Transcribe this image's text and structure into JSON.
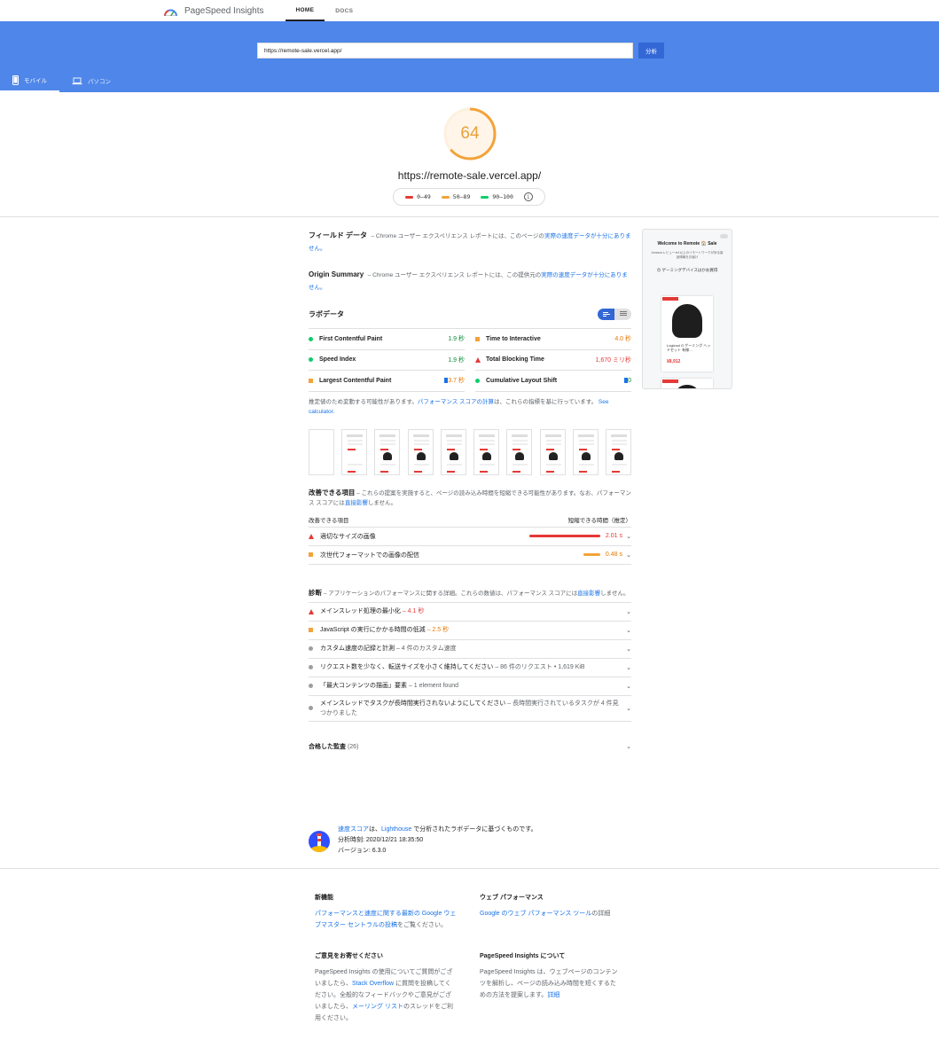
{
  "header": {
    "title": "PageSpeed Insights",
    "tabs": [
      "HOME",
      "DOCS"
    ]
  },
  "search": {
    "url": "https://remote-sale.vercel.app/",
    "analyze_label": "分析"
  },
  "device_tabs": [
    "モバイル",
    "パソコン"
  ],
  "score": {
    "value": "64",
    "url": "https://remote-sale.vercel.app/",
    "legend": [
      "0–49",
      "50–89",
      "90–100"
    ]
  },
  "field_data": {
    "title": "フィールド データ",
    "desc_pre": "– Chrome ユーザー エクスペリエンス レポートには、このページの",
    "desc_link": "実際の速度データが十分にありません。"
  },
  "origin_summary": {
    "title": "Origin Summary",
    "desc_pre": "– Chrome ユーザー エクスペリエンス レポートには、この提供元の",
    "desc_link": "実際の速度データが十分にありません。"
  },
  "lab": {
    "title": "ラボデータ",
    "metrics": [
      {
        "label": "First Contentful Paint",
        "value": "1.9 秒",
        "status": "good"
      },
      {
        "label": "Time to Interactive",
        "value": "4.0 秒",
        "status": "average"
      },
      {
        "label": "Speed Index",
        "value": "1.9 秒",
        "status": "good"
      },
      {
        "label": "Total Blocking Time",
        "value": "1,670 ミリ秒",
        "status": "poor"
      },
      {
        "label": "Largest Contentful Paint",
        "value": "3.7 秒",
        "status": "average"
      },
      {
        "label": "Cumulative Layout Shift",
        "value": "0",
        "status": "good"
      }
    ],
    "note_pre": "推定値のため変動する可能性があります。",
    "note_link": "パフォーマンス スコアの計算",
    "note_post": "は、これらの指標を基に行っています。",
    "note_calc": "See calculator."
  },
  "opportunities": {
    "title": "改善できる項目",
    "desc_pre": "– これらの提案を実施すると、ページの読み込み時間を短縮できる可能性があります。なお、パフォーマンス スコアには",
    "desc_link": "直接影響",
    "desc_post": "しません。",
    "col_left": "改善できる項目",
    "col_right": "短縮できる時間（推定）",
    "items": [
      {
        "label": "適切なサイズの画像",
        "value": "2.01 s",
        "savings_fraction": 1.0,
        "status": "poor"
      },
      {
        "label": "次世代フォーマットでの画像の配信",
        "value": "0.48 s",
        "savings_fraction": 0.24,
        "status": "average"
      }
    ]
  },
  "diagnostics": {
    "title": "診断",
    "desc_pre": "– アプリケーションのパフォーマンスに関する詳細。これらの数値は、パフォーマンス スコアには",
    "desc_link": "直接影響",
    "desc_post": "しません。",
    "items": [
      {
        "label": "メインスレッド処理の最小化",
        "extra": "– 4.1 秒",
        "status": "poor"
      },
      {
        "label": "JavaScript の実行にかかる時間の低減",
        "extra": "– 2.5 秒",
        "status": "average"
      },
      {
        "label": "カスタム速度の記録と計測",
        "extra": "– 4 件のカスタム速度",
        "status": "info"
      },
      {
        "label": "リクエスト数を少なく、転送サイズを小さく維持してください",
        "extra": "– 86 件のリクエスト • 1,619 KiB",
        "status": "info"
      },
      {
        "label": "「最大コンテンツの描画」要素",
        "extra": "– 1 element found",
        "status": "info"
      },
      {
        "label": "メインスレッドでタスクが長時間実行されないようにしてください",
        "extra": "– 長時間実行されているタスクが 4 件見つかりました",
        "status": "info"
      }
    ]
  },
  "passed": {
    "title": "合格した監査",
    "count": "(26)"
  },
  "preview": {
    "title": "Welcome to Remote 🏠 Sale",
    "subtitle": "Amazonレビュー★4以上のリモートワークが捗る製品情報をお届け",
    "category": "😊 ゲーミングデバイスはかお買得",
    "product_name": "Logicool G ゲーミング ヘッドセット 有線…",
    "product_price": "¥8,912"
  },
  "lighthouse": {
    "link1": "速度スコア",
    "mid1": "は、",
    "link2": "Lighthouse",
    "mid2": " で分析されたラボデータに基づくものです。",
    "time": "分析時刻: 2020/12/21 18:35:50",
    "version": "バージョン: 6.3.0"
  },
  "footer": {
    "new": {
      "title": "新機能",
      "link": "パフォーマンスと速度に関する最新の Google ウェブマスター セントラルの投稿",
      "post": "をご覧ください。"
    },
    "web_perf": {
      "title": "ウェブ パフォーマンス",
      "link": "Google のウェブ パフォーマンス ツール",
      "post": "の詳細"
    },
    "feedback": {
      "title": "ご意見をお寄せください",
      "pre": "PageSpeed Insights の使用についてご質問がございましたら、",
      "link1": "Stack Overflow",
      "mid": " に質問を投稿してください。全般的なフィードバックやご意見がございましたら、",
      "link2": "メーリング リスト",
      "post": "のスレッドをご利用ください。"
    },
    "about": {
      "title": "PageSpeed Insights について",
      "pre": "PageSpeed Insights は、ウェブページのコンテンツを解析し、ページの読み込み時間を短くするための方法を提案します。",
      "link": "詳細"
    }
  }
}
